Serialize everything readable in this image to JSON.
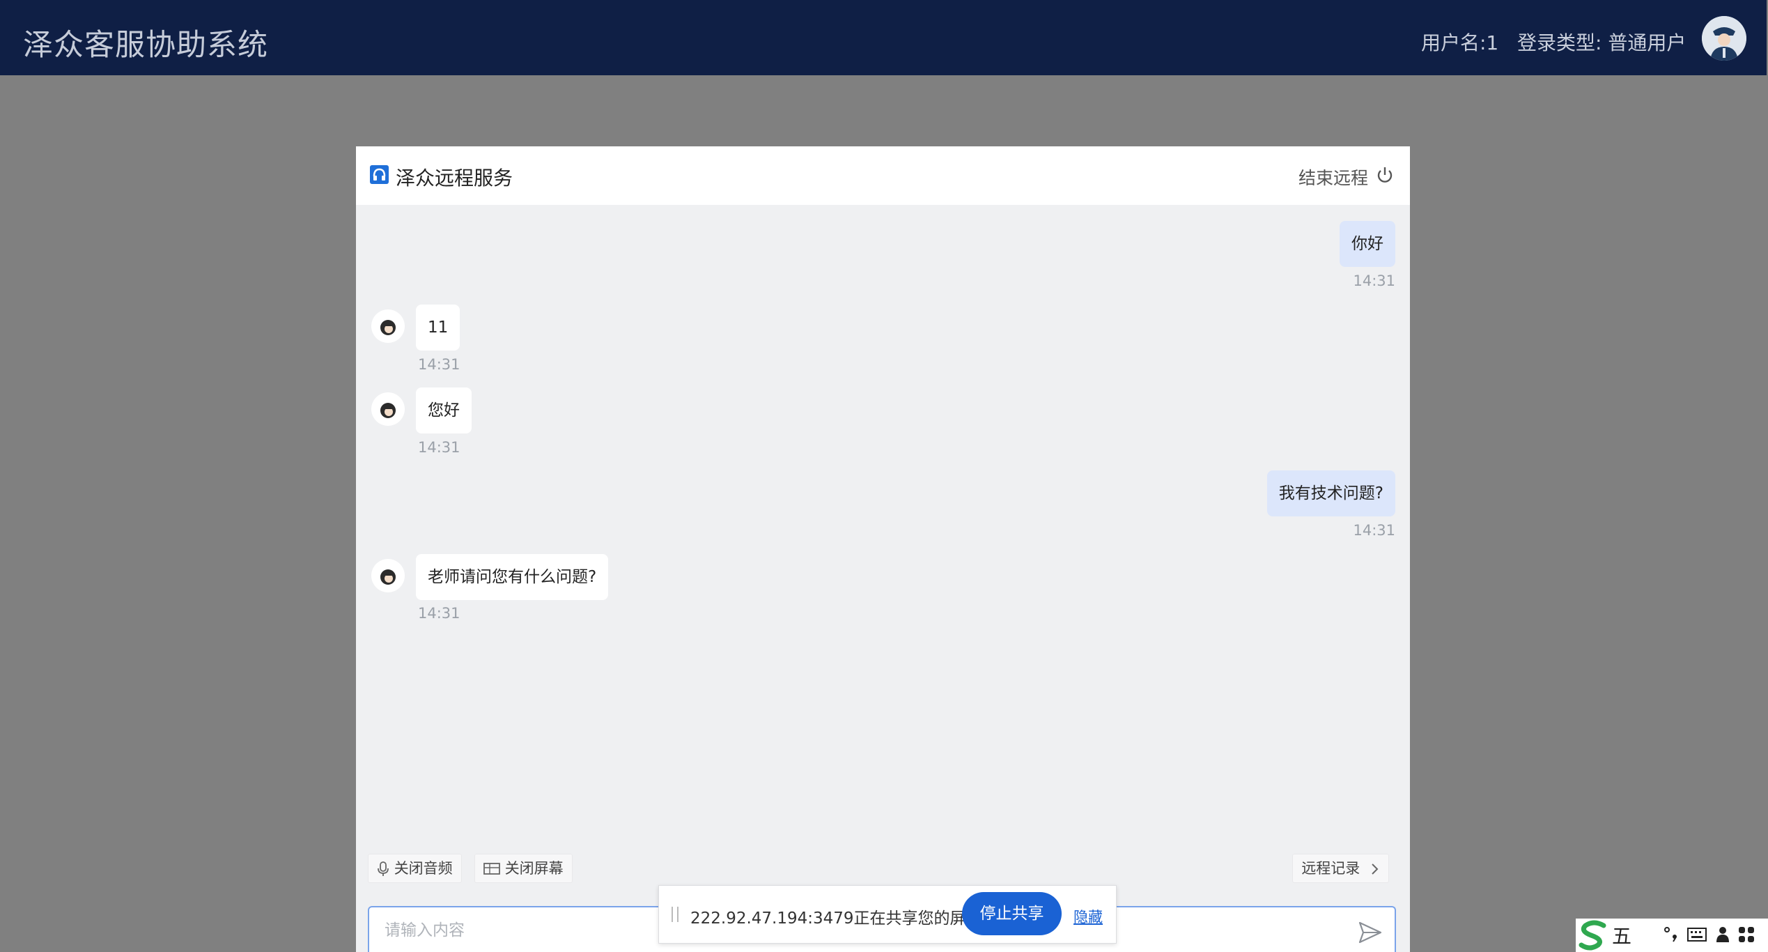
{
  "header": {
    "app_title": "泽众客服协助系统",
    "username": "用户名:1",
    "login_type": "登录类型: 普通用户"
  },
  "dialog": {
    "title": "泽众远程服务",
    "end_remote": "结束远程"
  },
  "messages": [
    {
      "from": "me",
      "text": "你好",
      "time": "14:31"
    },
    {
      "from": "agent",
      "text": "11",
      "time": "14:31"
    },
    {
      "from": "agent",
      "text": "您好",
      "time": "14:31"
    },
    {
      "from": "me",
      "text": "我有技术问题?",
      "time": "14:31"
    },
    {
      "from": "agent",
      "text": "老师请问您有什么问题?",
      "time": "14:31"
    }
  ],
  "toolbar": {
    "close_audio": "关闭音频",
    "close_screen": "关闭屏幕",
    "remote_records": "远程记录"
  },
  "input": {
    "placeholder": "请输入内容",
    "value": ""
  },
  "share_bar": {
    "text": "222.92.47.194:3479正在共享您的屏幕。",
    "stop_label": "停止共享",
    "hide_label": "隐藏"
  },
  "ime": {
    "mode": "五"
  },
  "colors": {
    "topbar": "#0f1f45",
    "primary": "#1a62d4",
    "my_bubble": "#dce6fb"
  }
}
